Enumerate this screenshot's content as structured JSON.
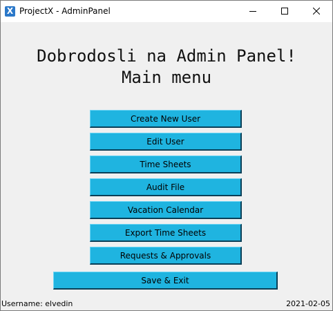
{
  "window": {
    "title": "ProjectX - AdminPanel",
    "icon_glyph": "X",
    "icon": "app-icon",
    "controls": [
      "minimize-icon",
      "maximize-icon",
      "close-icon"
    ]
  },
  "heading": {
    "line1": "Dobrodosli na Admin Panel!",
    "line2": "Main menu"
  },
  "menu": {
    "create_user": "Create New User",
    "edit_user": "Edit User",
    "time_sheets": "Time Sheets",
    "audit_file": "Audit File",
    "vacation_calendar": "Vacation Calendar",
    "export_time_sheets": "Export Time Sheets",
    "requests_approvals": "Requests & Approvals",
    "save_exit": "Save & Exit"
  },
  "status": {
    "username": "Username: elvedin",
    "date": "2021-02-05"
  },
  "colors": {
    "button_bg": "#1fb4e0",
    "window_bg": "#f0f0f0",
    "titlebar_bg": "#ffffff"
  }
}
